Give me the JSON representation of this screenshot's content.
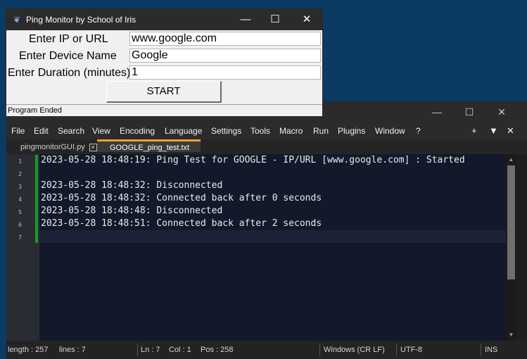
{
  "tk": {
    "title": "Ping Monitor by School of Iris",
    "labels": {
      "ip": "Enter IP or URL",
      "device": "Enter Device Name",
      "duration": "Enter Duration (minutes)"
    },
    "values": {
      "ip": "www.google.com",
      "device": "Google",
      "duration": "1"
    },
    "start_label": "START",
    "status": "Program Ended"
  },
  "editor": {
    "menu": [
      "File",
      "Edit",
      "Search",
      "View",
      "Encoding",
      "Language",
      "Settings",
      "Tools",
      "Macro",
      "Run",
      "Plugins",
      "Window",
      "?"
    ],
    "menu_right": {
      "plus": "+",
      "down": "▼",
      "close": "✕"
    },
    "tabs": [
      {
        "label": "pingmonitorGUI.py"
      },
      {
        "label": "GOOGLE_ping_test.txt"
      }
    ],
    "line_numbers": [
      "1",
      "2",
      "3",
      "4",
      "5",
      "6",
      "7"
    ],
    "lines": [
      "2023-05-28 18:48:19: Ping Test for GOOGLE - IP/URL [www.google.com] : Started",
      "",
      "2023-05-28 18:48:32: Disconnected",
      "2023-05-28 18:48:32: Connected back after 0 seconds",
      "2023-05-28 18:48:48: Disconnected",
      "2023-05-28 18:48:51: Connected back after 2 seconds",
      ""
    ],
    "status": {
      "length": "length : 257",
      "lines": "lines : 7",
      "ln": "Ln : 7",
      "col": "Col : 1",
      "pos": "Pos : 258",
      "eol": "Windows (CR LF)",
      "encoding": "UTF-8",
      "mode": "INS"
    }
  },
  "icons": {
    "minimize": "—",
    "maximize": "☐",
    "close": "✕",
    "feather": "🪶"
  }
}
